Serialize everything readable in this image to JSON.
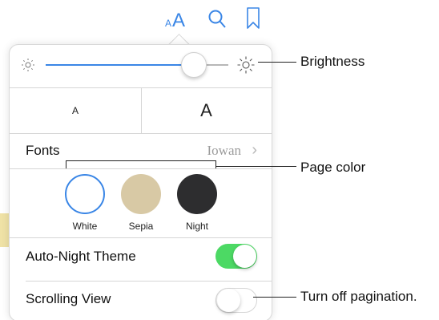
{
  "popover": {
    "brightness": {
      "level": 0.77
    },
    "font_size": {
      "smaller_label": "A",
      "larger_label": "A"
    },
    "fonts": {
      "label": "Fonts",
      "current_font": "Iowan",
      "chevron": "›"
    },
    "themes": [
      {
        "label": "White",
        "color": "#ffffff",
        "selected": true
      },
      {
        "label": "Sepia",
        "color": "#d8c9a5",
        "selected": false
      },
      {
        "label": "Night",
        "color": "#2d2d2f",
        "selected": false
      }
    ],
    "auto_night_theme": {
      "label": "Auto-Night Theme",
      "enabled": true
    },
    "scrolling_view": {
      "label": "Scrolling View",
      "enabled": false
    }
  },
  "toolbar": {
    "font_size_icon_small": "A",
    "font_size_icon_large": "A",
    "icons": [
      "font-size-icon",
      "search-icon",
      "bookmark-icon"
    ]
  },
  "callouts": {
    "brightness": "Brightness",
    "page_color": "Page color",
    "pagination": "Turn off pagination."
  },
  "colors": {
    "accent": "#3a86e6",
    "toggle_on": "#4cd964"
  }
}
